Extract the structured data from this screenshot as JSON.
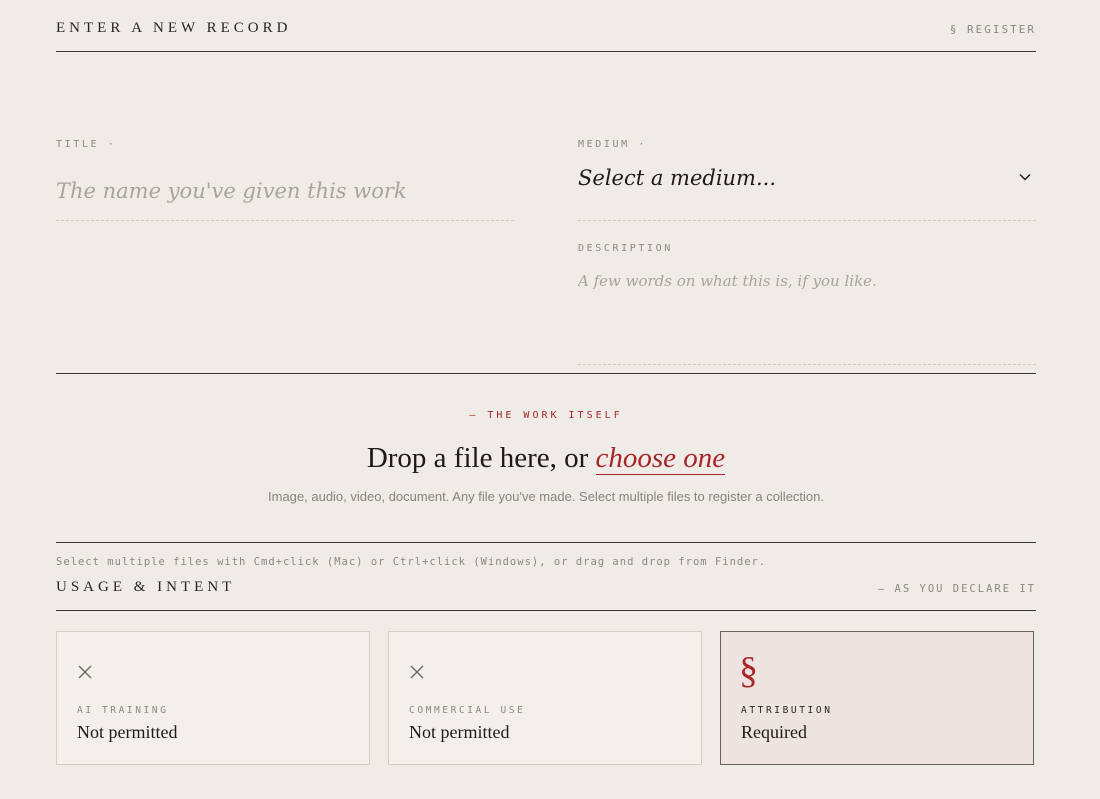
{
  "header": {
    "title": "ENTER A NEW RECORD",
    "register_link": "§ REGISTER"
  },
  "form": {
    "title_label": "TITLE ·",
    "title_placeholder": "The name you've given this work",
    "medium_label": "MEDIUM ·",
    "medium_value": "Select a medium...",
    "description_label": "DESCRIPTION",
    "description_placeholder": "A few words on what this is, if you like."
  },
  "dropzone": {
    "kicker": "— THE WORK ITSELF",
    "headline_prefix": "Drop a file here, or ",
    "headline_link": "choose one",
    "subtext": "Image, audio, video, document. Any file you've made. Select multiple files to register a collection."
  },
  "hint": "Select multiple files with Cmd+click (Mac) or Ctrl+click (Windows), or drag and drop from Finder.",
  "usage": {
    "title": "USAGE & INTENT",
    "note": "— AS YOU DECLARE IT",
    "cards": [
      {
        "icon": "x-icon",
        "label": "AI TRAINING",
        "value": "Not permitted",
        "selected": false
      },
      {
        "icon": "x-icon",
        "label": "COMMERCIAL USE",
        "value": "Not permitted",
        "selected": false
      },
      {
        "icon": "section-icon",
        "glyph": "§",
        "label": "ATTRIBUTION",
        "value": "Required",
        "selected": true
      }
    ]
  },
  "colors": {
    "background": "#efebe7",
    "accent": "#a8262a",
    "ink": "#1e1a17",
    "muted": "#8e8680"
  }
}
